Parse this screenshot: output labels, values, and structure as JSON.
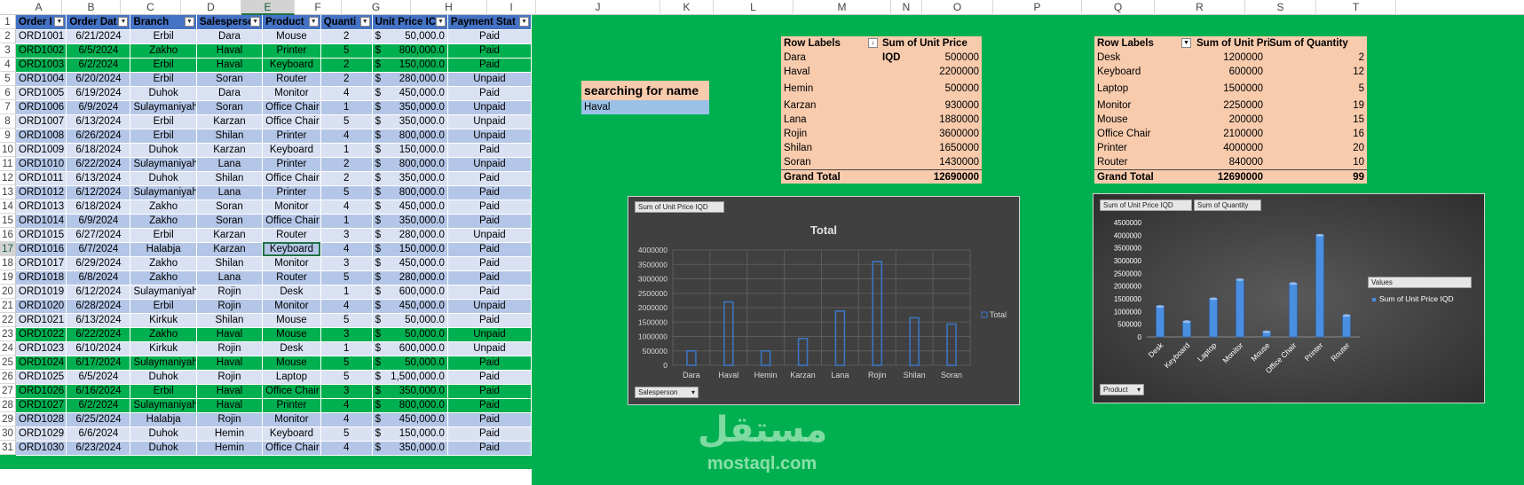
{
  "columns": [
    "A",
    "B",
    "C",
    "D",
    "E",
    "F",
    "G",
    "H",
    "I",
    "J",
    "K",
    "L",
    "M",
    "N",
    "O",
    "P",
    "Q",
    "R",
    "S",
    "T"
  ],
  "selected_column": "E",
  "selected_row": 17,
  "table": {
    "headers": [
      "Order I",
      "Order Dat",
      "Branch",
      "Salesperso",
      "Product",
      "Quanti",
      "Unit Price IC",
      "Payment Stat"
    ],
    "rows": [
      [
        "ORD1001",
        "6/21/2024",
        "Erbil",
        "Dara",
        "Mouse",
        "2",
        "$",
        "50,000.0",
        "Paid"
      ],
      [
        "ORD1002",
        "6/5/2024",
        "Zakho",
        "Haval",
        "Printer",
        "5",
        "$",
        "800,000.0",
        "Paid"
      ],
      [
        "ORD1003",
        "6/2/2024",
        "Erbil",
        "Haval",
        "Keyboard",
        "2",
        "$",
        "150,000.0",
        "Paid"
      ],
      [
        "ORD1004",
        "6/20/2024",
        "Erbil",
        "Soran",
        "Router",
        "2",
        "$",
        "280,000.0",
        "Unpaid"
      ],
      [
        "ORD1005",
        "6/19/2024",
        "Duhok",
        "Dara",
        "Monitor",
        "4",
        "$",
        "450,000.0",
        "Paid"
      ],
      [
        "ORD1006",
        "6/9/2024",
        "Sulaymaniyah",
        "Soran",
        "Office Chair",
        "1",
        "$",
        "350,000.0",
        "Unpaid"
      ],
      [
        "ORD1007",
        "6/13/2024",
        "Erbil",
        "Karzan",
        "Office Chair",
        "5",
        "$",
        "350,000.0",
        "Unpaid"
      ],
      [
        "ORD1008",
        "6/26/2024",
        "Erbil",
        "Shilan",
        "Printer",
        "4",
        "$",
        "800,000.0",
        "Unpaid"
      ],
      [
        "ORD1009",
        "6/18/2024",
        "Duhok",
        "Karzan",
        "Keyboard",
        "1",
        "$",
        "150,000.0",
        "Paid"
      ],
      [
        "ORD1010",
        "6/22/2024",
        "Sulaymaniyah",
        "Lana",
        "Printer",
        "2",
        "$",
        "800,000.0",
        "Unpaid"
      ],
      [
        "ORD1011",
        "6/13/2024",
        "Duhok",
        "Shilan",
        "Office Chair",
        "2",
        "$",
        "350,000.0",
        "Paid"
      ],
      [
        "ORD1012",
        "6/12/2024",
        "Sulaymaniyah",
        "Lana",
        "Printer",
        "5",
        "$",
        "800,000.0",
        "Paid"
      ],
      [
        "ORD1013",
        "6/18/2024",
        "Zakho",
        "Soran",
        "Monitor",
        "4",
        "$",
        "450,000.0",
        "Paid"
      ],
      [
        "ORD1014",
        "6/9/2024",
        "Zakho",
        "Soran",
        "Office Chair",
        "1",
        "$",
        "350,000.0",
        "Paid"
      ],
      [
        "ORD1015",
        "6/27/2024",
        "Erbil",
        "Karzan",
        "Router",
        "3",
        "$",
        "280,000.0",
        "Unpaid"
      ],
      [
        "ORD1016",
        "6/7/2024",
        "Halabja",
        "Karzan",
        "Keyboard",
        "4",
        "$",
        "150,000.0",
        "Paid"
      ],
      [
        "ORD1017",
        "6/29/2024",
        "Zakho",
        "Shilan",
        "Monitor",
        "3",
        "$",
        "450,000.0",
        "Paid"
      ],
      [
        "ORD1018",
        "6/8/2024",
        "Zakho",
        "Lana",
        "Router",
        "5",
        "$",
        "280,000.0",
        "Paid"
      ],
      [
        "ORD1019",
        "6/12/2024",
        "Sulaymaniyah",
        "Rojin",
        "Desk",
        "1",
        "$",
        "600,000.0",
        "Paid"
      ],
      [
        "ORD1020",
        "6/28/2024",
        "Erbil",
        "Rojin",
        "Monitor",
        "4",
        "$",
        "450,000.0",
        "Unpaid"
      ],
      [
        "ORD1021",
        "6/13/2024",
        "Kirkuk",
        "Shilan",
        "Mouse",
        "5",
        "$",
        "50,000.0",
        "Paid"
      ],
      [
        "ORD1022",
        "6/22/2024",
        "Zakho",
        "Haval",
        "Mouse",
        "3",
        "$",
        "50,000.0",
        "Unpaid"
      ],
      [
        "ORD1023",
        "6/10/2024",
        "Kirkuk",
        "Rojin",
        "Desk",
        "1",
        "$",
        "600,000.0",
        "Unpaid"
      ],
      [
        "ORD1024",
        "6/17/2024",
        "Sulaymaniyah",
        "Haval",
        "Mouse",
        "5",
        "$",
        "50,000.0",
        "Paid"
      ],
      [
        "ORD1025",
        "6/5/2024",
        "Duhok",
        "Rojin",
        "Laptop",
        "5",
        "$",
        "1,500,000.0",
        "Paid"
      ],
      [
        "ORD1026",
        "6/16/2024",
        "Erbil",
        "Haval",
        "Office Chair",
        "3",
        "$",
        "350,000.0",
        "Paid"
      ],
      [
        "ORD1027",
        "6/2/2024",
        "Sulaymaniyah",
        "Haval",
        "Printer",
        "4",
        "$",
        "800,000.0",
        "Paid"
      ],
      [
        "ORD1028",
        "6/25/2024",
        "Halabja",
        "Rojin",
        "Monitor",
        "4",
        "$",
        "450,000.0",
        "Paid"
      ],
      [
        "ORD1029",
        "6/6/2024",
        "Duhok",
        "Hemin",
        "Keyboard",
        "5",
        "$",
        "150,000.0",
        "Paid"
      ],
      [
        "ORD1030",
        "6/23/2024",
        "Duhok",
        "Hemin",
        "Office Chair",
        "4",
        "$",
        "350,000.0",
        "Paid"
      ]
    ]
  },
  "search": {
    "title": "searching for name",
    "value": "Haval"
  },
  "pivot1": {
    "header_label": "Row Labels",
    "header_value": "Sum of Unit Price IQD",
    "rows": [
      {
        "label": "Dara",
        "value": "500000"
      },
      {
        "label": "Haval",
        "value": "2200000"
      },
      {
        "label": "Hemin",
        "value": "500000"
      },
      {
        "label": "Karzan",
        "value": "930000"
      },
      {
        "label": "Lana",
        "value": "1880000"
      },
      {
        "label": "Rojin",
        "value": "3600000"
      },
      {
        "label": "Shilan",
        "value": "1650000"
      },
      {
        "label": "Soran",
        "value": "1430000"
      }
    ],
    "total_label": "Grand Total",
    "total_value": "12690000"
  },
  "pivot2": {
    "header_label": "Row Labels",
    "header_value1": "Sum of Unit Pric",
    "header_value2": "Sum of Quantity",
    "rows": [
      {
        "label": "Desk",
        "v1": "1200000",
        "v2": "2"
      },
      {
        "label": "Keyboard",
        "v1": "600000",
        "v2": "12"
      },
      {
        "label": "Laptop",
        "v1": "1500000",
        "v2": "5"
      },
      {
        "label": "Monitor",
        "v1": "2250000",
        "v2": "19"
      },
      {
        "label": "Mouse",
        "v1": "200000",
        "v2": "15"
      },
      {
        "label": "Office Chair",
        "v1": "2100000",
        "v2": "16"
      },
      {
        "label": "Printer",
        "v1": "4000000",
        "v2": "20"
      },
      {
        "label": "Router",
        "v1": "840000",
        "v2": "10"
      }
    ],
    "total_label": "Grand Total",
    "total_v1": "12690000",
    "total_v2": "99"
  },
  "chart1_ui": {
    "field_button": "Sum of Unit Price IQD",
    "axis_button": "Salesperson"
  },
  "chart2_ui": {
    "field_button1": "Sum of Unit Price IQD",
    "field_button2": "Sum of Quantity",
    "axis_button": "Product",
    "legend_header": "Values"
  },
  "chart_data": [
    {
      "type": "bar",
      "title": "Total",
      "categories": [
        "Dara",
        "Haval",
        "Hemin",
        "Karzan",
        "Lana",
        "Rojin",
        "Shilan",
        "Soran"
      ],
      "series": [
        {
          "name": "Total",
          "values": [
            500000,
            2200000,
            500000,
            930000,
            1880000,
            3600000,
            1650000,
            1430000
          ]
        }
      ],
      "yticks": [
        "0",
        "500000",
        "1000000",
        "1500000",
        "2000000",
        "2500000",
        "3000000",
        "3500000",
        "4000000"
      ],
      "ylim": [
        0,
        4000000
      ],
      "grid": true,
      "legend": "right",
      "colors": {
        "bar_edge": "#3a78c8",
        "background": "#404040",
        "text": "#d9d9d9"
      }
    },
    {
      "type": "bar",
      "title": "",
      "categories": [
        "Desk",
        "Keyboard",
        "Laptop",
        "Monitor",
        "Mouse",
        "Office Chair",
        "Printer",
        "Router"
      ],
      "series": [
        {
          "name": "Sum of Unit Price IQD",
          "values": [
            1200000,
            600000,
            1500000,
            2250000,
            200000,
            2100000,
            4000000,
            840000
          ]
        },
        {
          "values": [
            2,
            12,
            5,
            19,
            15,
            16,
            20,
            10
          ]
        }
      ],
      "yticks": [
        "0",
        "500000",
        "1000000",
        "1500000",
        "2000000",
        "2500000",
        "3000000",
        "3500000",
        "4000000",
        "4500000"
      ],
      "ylim": [
        0,
        4500000
      ],
      "grid": false,
      "legend": "right",
      "colors": {
        "bar": "#4a8ee0",
        "background": "#3a3a3a",
        "text": "#ffffff"
      }
    }
  ],
  "watermark": {
    "arabic": "مستقل",
    "latin": "mostaql.com"
  }
}
